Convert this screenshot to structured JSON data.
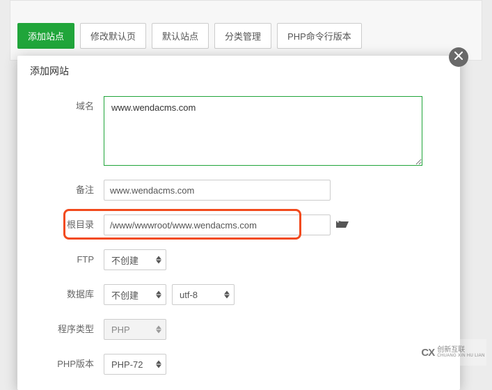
{
  "toolbar": {
    "add_site": "添加站点",
    "modify_default": "修改默认页",
    "default_site": "默认站点",
    "category": "分类管理",
    "php_version": "PHP命令行版本"
  },
  "modal": {
    "title": "添加网站",
    "labels": {
      "domain": "域名",
      "remark": "备注",
      "root": "根目录",
      "ftp": "FTP",
      "database": "数据库",
      "program_type": "程序类型",
      "php_version": "PHP版本"
    },
    "values": {
      "domain": "www.wendacms.com",
      "remark": "www.wendacms.com",
      "root": "/www/wwwroot/www.wendacms.com",
      "ftp": "不创建",
      "database": "不创建",
      "charset": "utf-8",
      "program_type": "PHP",
      "php_version": "PHP-72"
    }
  },
  "watermark": {
    "brand_initials": "CX",
    "brand_cn": "创新互联",
    "brand_py": "CHUANG XIN HU LIAN"
  }
}
